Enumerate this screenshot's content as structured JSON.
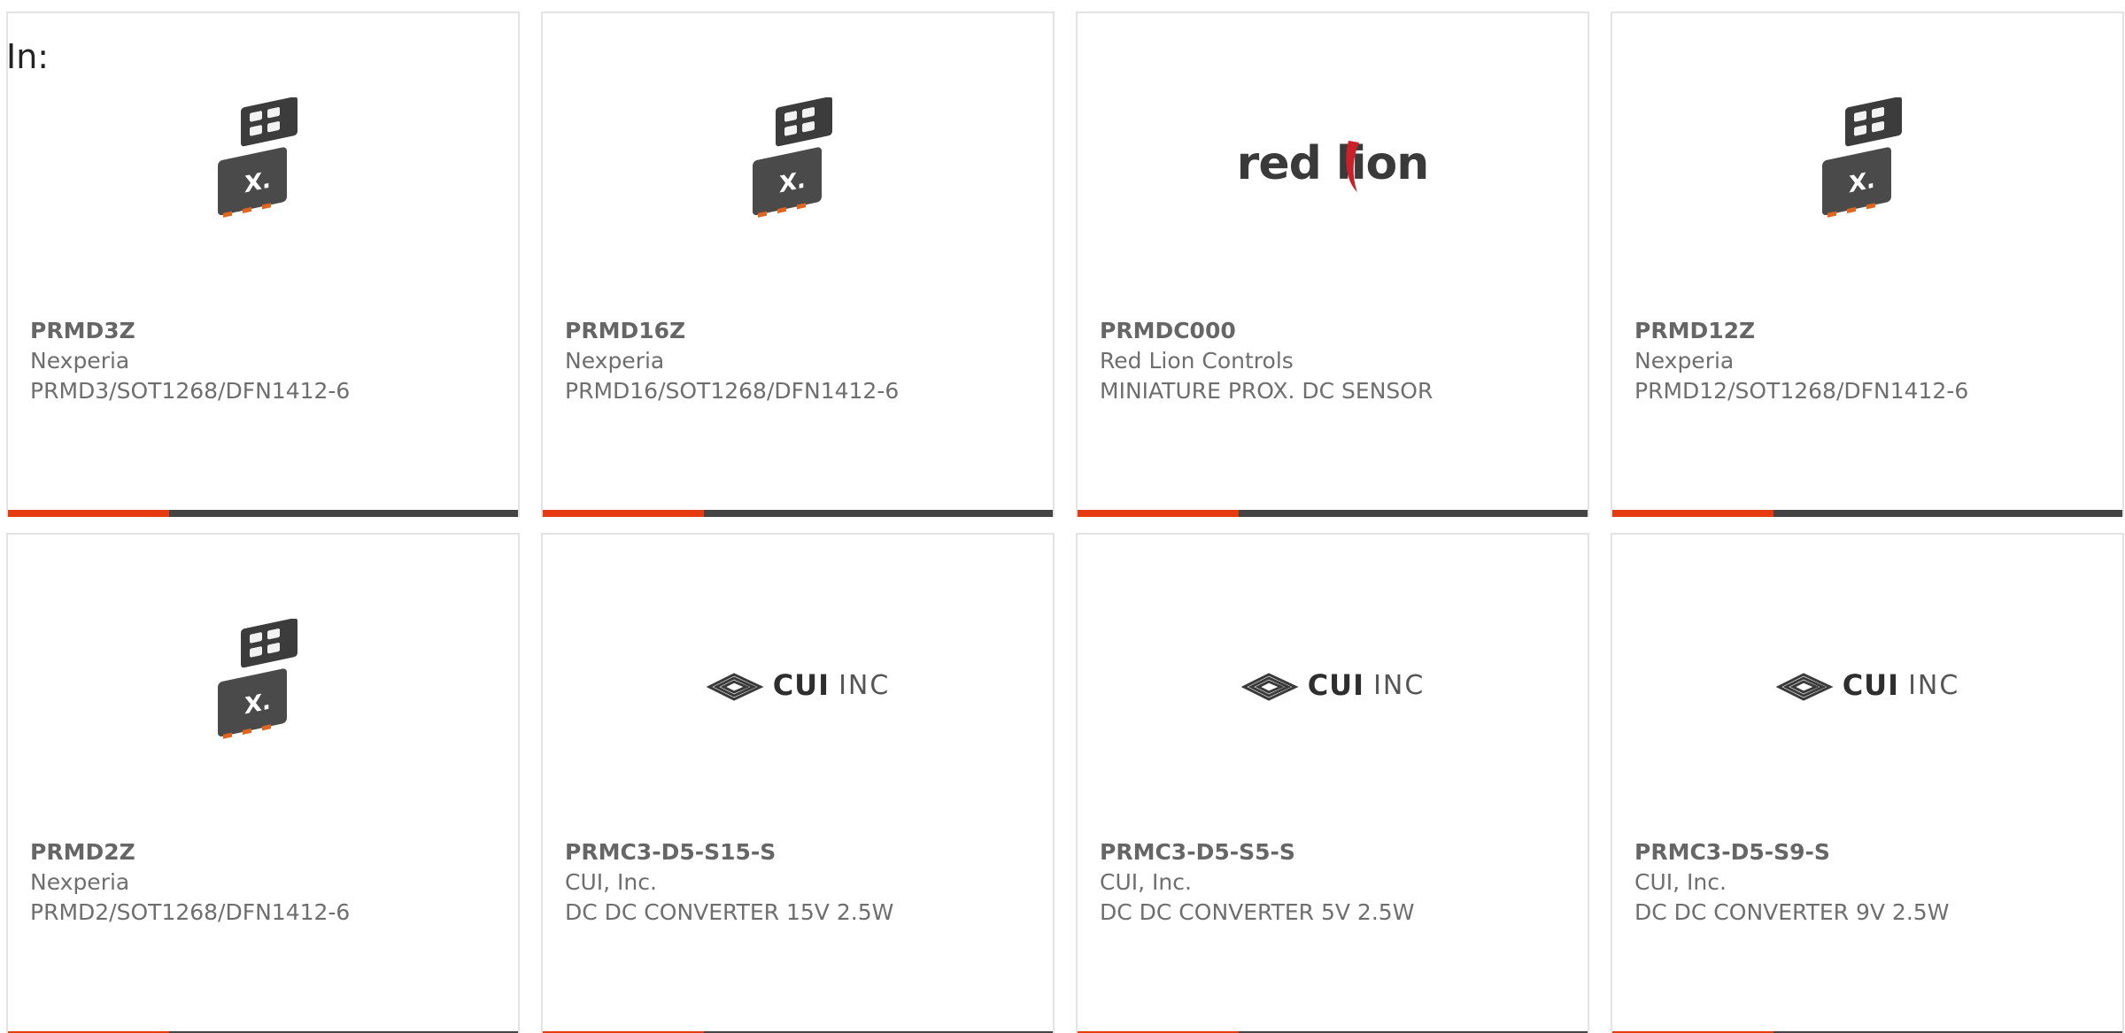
{
  "filter": {
    "label": "In:"
  },
  "colors": {
    "accent": "#e63a10",
    "bar": "#444444",
    "border": "#e3e3e3",
    "text": "#6e6e6e"
  },
  "products": [
    {
      "part_number": "PRMD3Z",
      "manufacturer": "Nexperia",
      "description": "PRMD3/SOT1268/DFN1412-6",
      "image": "nexperia-chip-icon"
    },
    {
      "part_number": "PRMD16Z",
      "manufacturer": "Nexperia",
      "description": "PRMD16/SOT1268/DFN1412-6",
      "image": "nexperia-chip-icon"
    },
    {
      "part_number": "PRMDC000",
      "manufacturer": "Red Lion Controls",
      "description": "MINIATURE PROX. DC SENSOR",
      "image": "red-lion-logo",
      "logo_text": "red lion"
    },
    {
      "part_number": "PRMD12Z",
      "manufacturer": "Nexperia",
      "description": "PRMD12/SOT1268/DFN1412-6",
      "image": "nexperia-chip-icon"
    },
    {
      "part_number": "PRMD2Z",
      "manufacturer": "Nexperia",
      "description": "PRMD2/SOT1268/DFN1412-6",
      "image": "nexperia-chip-icon"
    },
    {
      "part_number": "PRMC3-D5-S15-S",
      "manufacturer": "CUI, Inc.",
      "description": "DC DC CONVERTER 15V 2.5W",
      "image": "cui-logo",
      "logo_text_bold": "CUI",
      "logo_text_light": "INC"
    },
    {
      "part_number": "PRMC3-D5-S5-S",
      "manufacturer": "CUI, Inc.",
      "description": "DC DC CONVERTER 5V 2.5W",
      "image": "cui-logo",
      "logo_text_bold": "CUI",
      "logo_text_light": "INC"
    },
    {
      "part_number": "PRMC3-D5-S9-S",
      "manufacturer": "CUI, Inc.",
      "description": "DC DC CONVERTER 9V 2.5W",
      "image": "cui-logo",
      "logo_text_bold": "CUI",
      "logo_text_light": "INC"
    }
  ]
}
